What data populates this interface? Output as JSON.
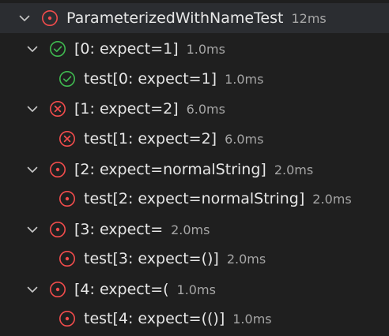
{
  "colors": {
    "background": "#1f1f1f",
    "selected_row": "#2b2d31",
    "passed": "#3fb950",
    "failed": "#f14c4c",
    "errored": "#f14c4c",
    "text": "#e6e6e6",
    "duration": "#a6a6a6"
  },
  "tree": [
    {
      "level": 0,
      "expanded": true,
      "status": "errored",
      "label": "ParameterizedWithNameTest",
      "duration": "12ms"
    },
    {
      "level": 1,
      "expanded": true,
      "status": "passed",
      "label": "[0: expect=1]",
      "duration": "1.0ms"
    },
    {
      "level": 2,
      "status": "passed",
      "label": "test[0: expect=1]",
      "duration": "1.0ms"
    },
    {
      "level": 1,
      "expanded": true,
      "status": "failed",
      "label": "[1: expect=2]",
      "duration": "6.0ms"
    },
    {
      "level": 2,
      "status": "failed",
      "label": "test[1: expect=2]",
      "duration": "6.0ms"
    },
    {
      "level": 1,
      "expanded": true,
      "status": "errored",
      "label": "[2: expect=normalString]",
      "duration": "2.0ms"
    },
    {
      "level": 2,
      "status": "errored",
      "label": "test[2: expect=normalString]",
      "duration": "2.0ms"
    },
    {
      "level": 1,
      "expanded": true,
      "status": "errored",
      "label": "[3: expect=",
      "duration": "2.0ms"
    },
    {
      "level": 2,
      "status": "errored",
      "label": "test[3: expect=()]",
      "duration": "2.0ms"
    },
    {
      "level": 1,
      "expanded": true,
      "status": "errored",
      "label": "[4: expect=(",
      "duration": "1.0ms"
    },
    {
      "level": 2,
      "status": "errored",
      "label": "test[4: expect=(()]",
      "duration": "1.0ms"
    }
  ]
}
